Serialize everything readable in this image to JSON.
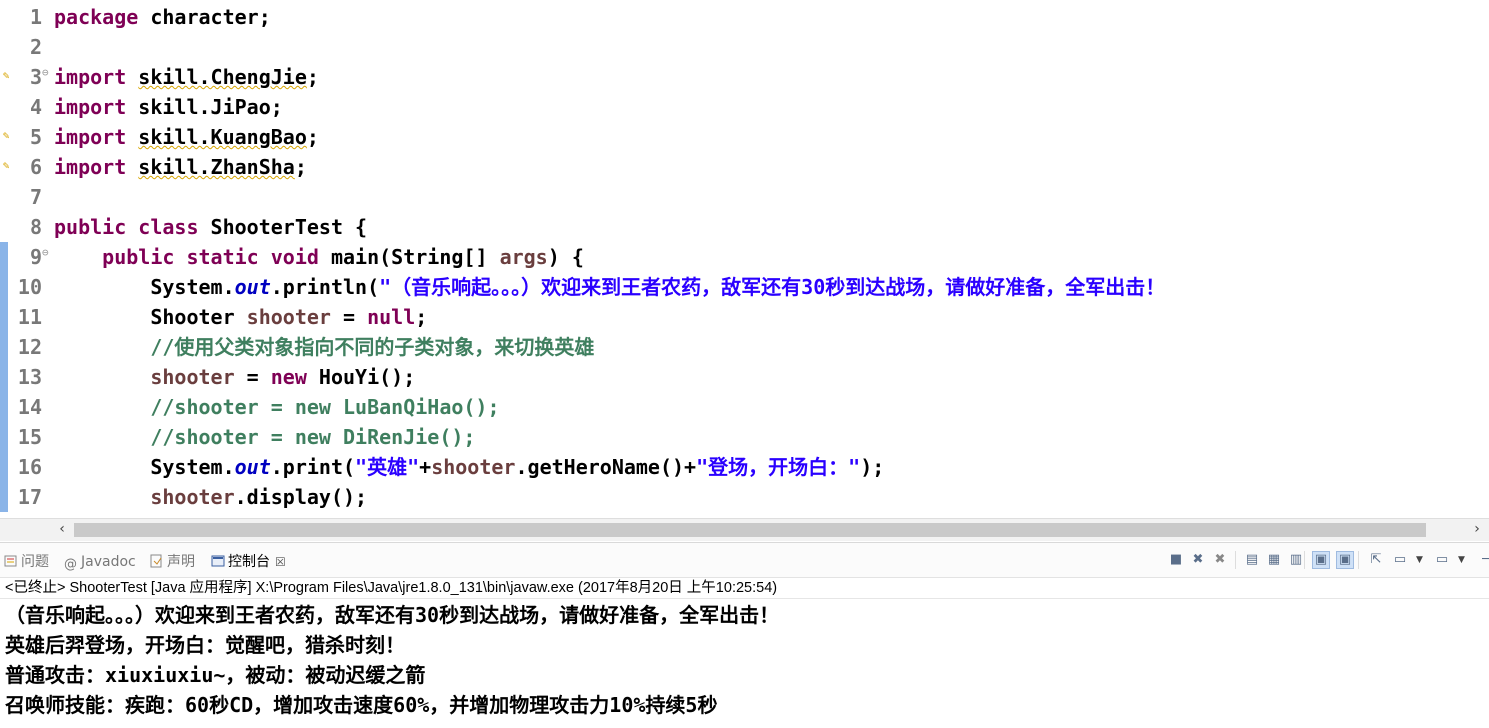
{
  "editor": {
    "lines": [
      {
        "n": "1",
        "tokens": [
          {
            "t": "kw",
            "v": "package"
          },
          {
            "t": "pl",
            "v": " character;"
          }
        ]
      },
      {
        "n": "2",
        "tokens": []
      },
      {
        "n": "3",
        "tokens": [
          {
            "t": "kw",
            "v": "import"
          },
          {
            "t": "pl",
            "v": " "
          },
          {
            "t": "warn",
            "v": "skill.ChengJie"
          },
          {
            "t": "pl",
            "v": ";"
          }
        ],
        "warning": true,
        "fold": true
      },
      {
        "n": "4",
        "tokens": [
          {
            "t": "kw",
            "v": "import"
          },
          {
            "t": "pl",
            "v": " skill.JiPao;"
          }
        ]
      },
      {
        "n": "5",
        "tokens": [
          {
            "t": "kw",
            "v": "import"
          },
          {
            "t": "pl",
            "v": " "
          },
          {
            "t": "warn",
            "v": "skill.KuangBao"
          },
          {
            "t": "pl",
            "v": ";"
          }
        ],
        "warning": true
      },
      {
        "n": "6",
        "tokens": [
          {
            "t": "kw",
            "v": "import"
          },
          {
            "t": "pl",
            "v": " "
          },
          {
            "t": "warn",
            "v": "skill.ZhanSha"
          },
          {
            "t": "pl",
            "v": ";"
          }
        ],
        "warning": true
      },
      {
        "n": "7",
        "tokens": []
      },
      {
        "n": "8",
        "tokens": [
          {
            "t": "kw",
            "v": "public"
          },
          {
            "t": "pl",
            "v": " "
          },
          {
            "t": "kw",
            "v": "class"
          },
          {
            "t": "pl",
            "v": " ShooterTest {"
          }
        ]
      },
      {
        "n": "9",
        "tokens": [
          {
            "t": "pl",
            "v": "    "
          },
          {
            "t": "kw",
            "v": "public"
          },
          {
            "t": "pl",
            "v": " "
          },
          {
            "t": "kw",
            "v": "static"
          },
          {
            "t": "pl",
            "v": " "
          },
          {
            "t": "kw",
            "v": "void"
          },
          {
            "t": "pl",
            "v": " main(String[] "
          },
          {
            "t": "var",
            "v": "args"
          },
          {
            "t": "pl",
            "v": ") {"
          }
        ],
        "fold": true,
        "changed": true
      },
      {
        "n": "10",
        "tokens": [
          {
            "t": "pl",
            "v": "        System."
          },
          {
            "t": "fld",
            "v": "out"
          },
          {
            "t": "pl",
            "v": ".println("
          },
          {
            "t": "str",
            "v": "\"（音乐响起。。。）欢迎来到王者农药，敌军还有30秒到达战场，请做好准备，全军出击！"
          }
        ],
        "changed": true
      },
      {
        "n": "11",
        "tokens": [
          {
            "t": "pl",
            "v": "        Shooter "
          },
          {
            "t": "var",
            "v": "shooter"
          },
          {
            "t": "pl",
            "v": " = "
          },
          {
            "t": "kw",
            "v": "null"
          },
          {
            "t": "pl",
            "v": ";"
          }
        ],
        "changed": true
      },
      {
        "n": "12",
        "tokens": [
          {
            "t": "pl",
            "v": "        "
          },
          {
            "t": "cm",
            "v": "//使用父类对象指向不同的子类对象，来切换英雄"
          }
        ],
        "changed": true
      },
      {
        "n": "13",
        "tokens": [
          {
            "t": "pl",
            "v": "        "
          },
          {
            "t": "var",
            "v": "shooter"
          },
          {
            "t": "pl",
            "v": " = "
          },
          {
            "t": "kw",
            "v": "new"
          },
          {
            "t": "pl",
            "v": " HouYi();"
          }
        ],
        "changed": true
      },
      {
        "n": "14",
        "tokens": [
          {
            "t": "pl",
            "v": "        "
          },
          {
            "t": "cm",
            "v": "//shooter = new LuBanQiHao();"
          }
        ],
        "changed": true
      },
      {
        "n": "15",
        "tokens": [
          {
            "t": "pl",
            "v": "        "
          },
          {
            "t": "cm",
            "v": "//shooter = new DiRenJie();"
          }
        ],
        "changed": true
      },
      {
        "n": "16",
        "tokens": [
          {
            "t": "pl",
            "v": "        System."
          },
          {
            "t": "fld",
            "v": "out"
          },
          {
            "t": "pl",
            "v": ".print("
          },
          {
            "t": "str",
            "v": "\"英雄\""
          },
          {
            "t": "pl",
            "v": "+"
          },
          {
            "t": "var",
            "v": "shooter"
          },
          {
            "t": "pl",
            "v": ".getHeroName()+"
          },
          {
            "t": "str",
            "v": "\"登场，开场白：\""
          },
          {
            "t": "pl",
            "v": ");"
          }
        ],
        "changed": true
      },
      {
        "n": "17",
        "tokens": [
          {
            "t": "pl",
            "v": "        "
          },
          {
            "t": "var",
            "v": "shooter"
          },
          {
            "t": "pl",
            "v": ".display();"
          }
        ],
        "changed": true
      }
    ]
  },
  "console": {
    "tabs": [
      {
        "label": "问题",
        "icon": "problems-icon",
        "active": false
      },
      {
        "label": "Javadoc",
        "icon": "at-icon",
        "active": false
      },
      {
        "label": "声明",
        "icon": "declaration-icon",
        "active": false
      },
      {
        "label": "控制台",
        "icon": "console-icon",
        "active": true,
        "close": "☒"
      }
    ],
    "status": "<已终止> ShooterTest [Java 应用程序] X:\\Program Files\\Java\\jre1.8.0_131\\bin\\javaw.exe (2017年8月20日 上午10:25:54)",
    "output": [
      "（音乐响起。。。）欢迎来到王者农药，敌军还有30秒到达战场，请做好准备，全军出击！",
      "英雄后羿登场，开场白：觉醒吧，猎杀时刻！",
      "普通攻击：xiuxiuxiu~，被动：被动迟缓之箭",
      "召唤师技能：疾跑：60秒CD，增加攻击速度60%，并增加物理攻击力10%持续5秒"
    ],
    "toolbar": [
      {
        "name": "terminate-icon",
        "glyph": "■"
      },
      {
        "name": "remove-launch-icon",
        "glyph": "✖"
      },
      {
        "name": "remove-all-icon",
        "glyph": "✖"
      },
      {
        "name": "clear-console-icon",
        "glyph": "▤"
      },
      {
        "name": "scroll-lock-icon",
        "glyph": "▦"
      },
      {
        "name": "word-wrap-icon",
        "glyph": "▥"
      },
      {
        "name": "show-on-stdout-icon",
        "glyph": "▣"
      },
      {
        "name": "show-on-stderr-icon",
        "glyph": "▣"
      },
      {
        "name": "pin-console-icon",
        "glyph": "⇱"
      },
      {
        "name": "display-console-icon",
        "glyph": "▭"
      },
      {
        "name": "open-console-icon",
        "glyph": "▭"
      },
      {
        "name": "minimize-icon",
        "glyph": "─"
      }
    ]
  },
  "colors": {
    "keyword": "#7f0055",
    "string": "#2a00ff",
    "comment": "#3f7f5f",
    "field": "#0000c0",
    "variable": "#6a3e3e"
  }
}
